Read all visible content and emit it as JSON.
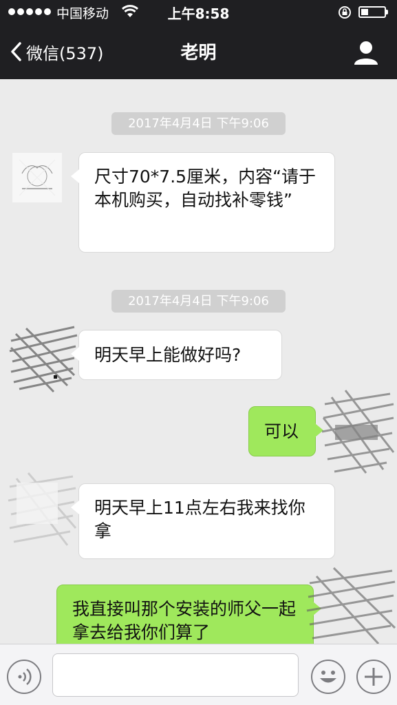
{
  "status_bar": {
    "carrier": "中国移动",
    "time": "上午8:58"
  },
  "nav": {
    "back_label": "微信(537)",
    "title": "老明"
  },
  "messages": [
    {
      "type": "time",
      "text": "2017年4月4日 下午9:06"
    },
    {
      "type": "in",
      "text": "尺寸70*7.5厘米，内容“请于本机购买，自动找补零钱”"
    },
    {
      "type": "time",
      "text": "2017年4月4日 下午9:06"
    },
    {
      "type": "in",
      "text": "明天早上能做好吗?"
    },
    {
      "type": "out",
      "text": "可以"
    },
    {
      "type": "in",
      "text": "明天早上11点左右我来找你拿"
    },
    {
      "type": "out",
      "text": "我直接叫那个安装的师父一起拿去给我你们算了"
    }
  ],
  "input": {
    "value": "",
    "placeholder": ""
  },
  "colors": {
    "header_bg": "#1f1f22",
    "chat_bg": "#ebebeb",
    "outgoing_bubble": "#9fe85c",
    "incoming_bubble": "#ffffff",
    "time_chip": "#d0d0d0"
  }
}
